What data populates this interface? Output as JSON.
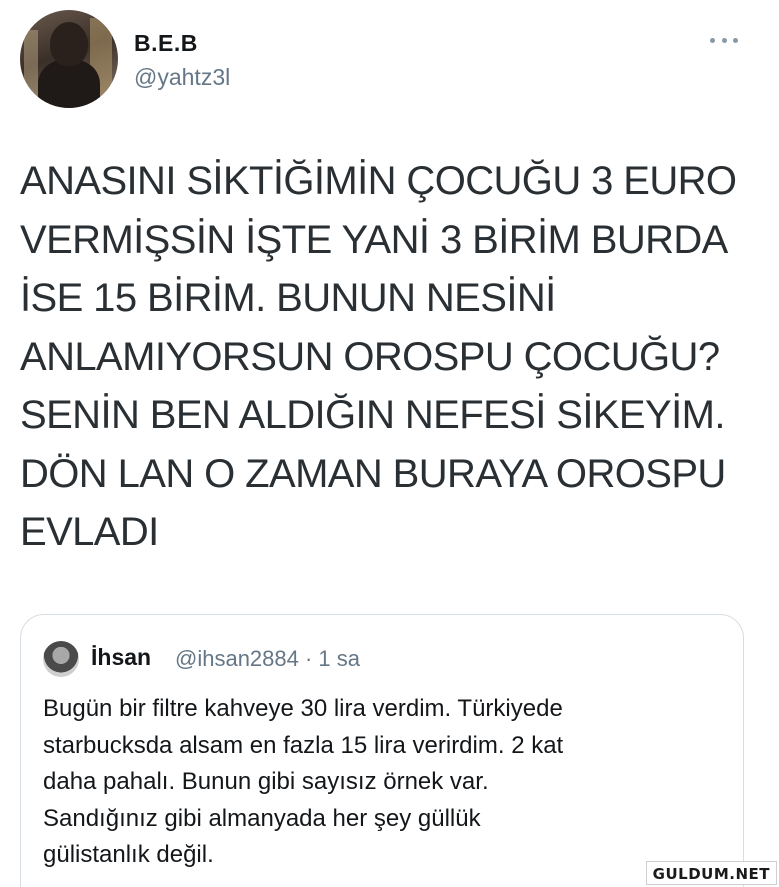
{
  "tweet": {
    "display_name": "B.E.B",
    "handle": "@yahtz3l",
    "text_lines": [
      "ANASINI SİKTİĞİMİN ÇOCUĞU 3 EURO",
      "VERMİŞSİN İŞTE YANİ 3 BİRİM BURDA",
      "İSE 15 BİRİM. BUNUN NESİNİ",
      "ANLAMIYORSUN OROSPU ÇOCUĞU?",
      "SENİN BEN ALDIĞIN NEFESİ SİKEYİM.",
      "DÖN LAN O ZAMAN BURAYA OROSPU",
      "EVLADI"
    ]
  },
  "quoted_tweet": {
    "display_name": "İhsan",
    "meta": "@ihsan2884 · 1 sa",
    "text_lines": [
      "Bugün bir filtre kahveye 30 lira verdim. Türkiyede",
      "starbucksda alsam en fazla 15 lira verirdim. 2 kat",
      "daha pahalı. Bunun gibi sayısız örnek var.",
      "Sandığınız gibi almanyada her şey güllük",
      "gülistanlık değil."
    ]
  },
  "watermark": "GULDUM.NET"
}
